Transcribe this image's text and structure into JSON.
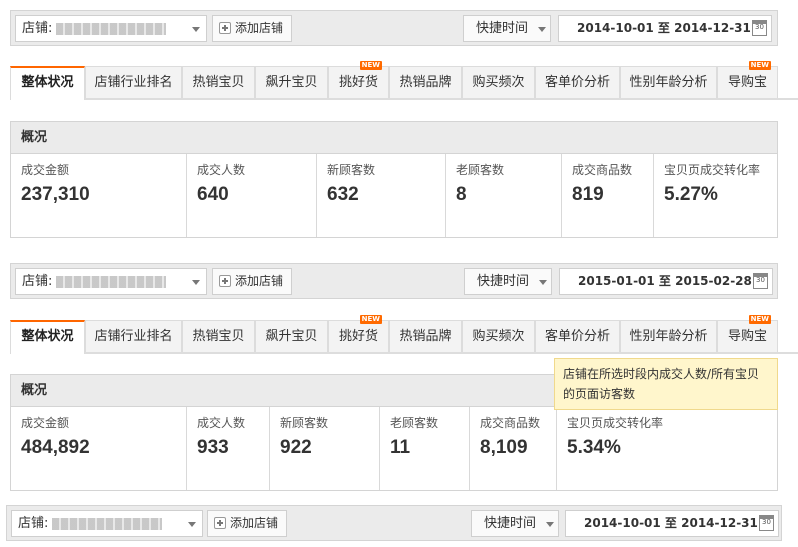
{
  "common": {
    "store_label": "店铺:",
    "add_store_label": "添加店铺",
    "quick_time_label": "快捷时间",
    "calendar_day": "30",
    "tabs": [
      {
        "label": "整体状况",
        "new": ""
      },
      {
        "label": "店铺行业排名",
        "new": ""
      },
      {
        "label": "热销宝贝",
        "new": ""
      },
      {
        "label": "飙升宝贝",
        "new": ""
      },
      {
        "label": "挑好货",
        "new": "NEW"
      },
      {
        "label": "热销品牌",
        "new": ""
      },
      {
        "label": "购买频次",
        "new": ""
      },
      {
        "label": "客单价分析",
        "new": ""
      },
      {
        "label": "性别年龄分析",
        "new": ""
      },
      {
        "label": "导购宝",
        "new": "NEW"
      }
    ],
    "overview_title": "概况"
  },
  "block1": {
    "date_range": "2014-10-01 至 2014-12-31",
    "metrics": [
      {
        "label": "成交金额",
        "value": "237,310"
      },
      {
        "label": "成交人数",
        "value": "640"
      },
      {
        "label": "新顾客数",
        "value": "632"
      },
      {
        "label": "老顾客数",
        "value": "8"
      },
      {
        "label": "成交商品数",
        "value": "819"
      },
      {
        "label": "宝贝页成交转化率",
        "value": "5.27%"
      }
    ]
  },
  "block2": {
    "date_range": "2015-01-01 至 2015-02-28",
    "metrics": [
      {
        "label": "成交金额",
        "value": "484,892"
      },
      {
        "label": "成交人数",
        "value": "933"
      },
      {
        "label": "新顾客数",
        "value": "922"
      },
      {
        "label": "老顾客数",
        "value": "11"
      },
      {
        "label": "成交商品数",
        "value": "8,109"
      },
      {
        "label": "宝贝页成交转化率",
        "value": "5.34%"
      }
    ],
    "tooltip": "店铺在所选时段内成交人数/所有宝贝的页面访客数"
  },
  "block3": {
    "date_range": "2014-10-01 至 2014-12-31"
  },
  "colors": {
    "accent": "#ff6600",
    "new_badge": "#ff6a00",
    "tooltip_bg": "#fff6cc"
  }
}
